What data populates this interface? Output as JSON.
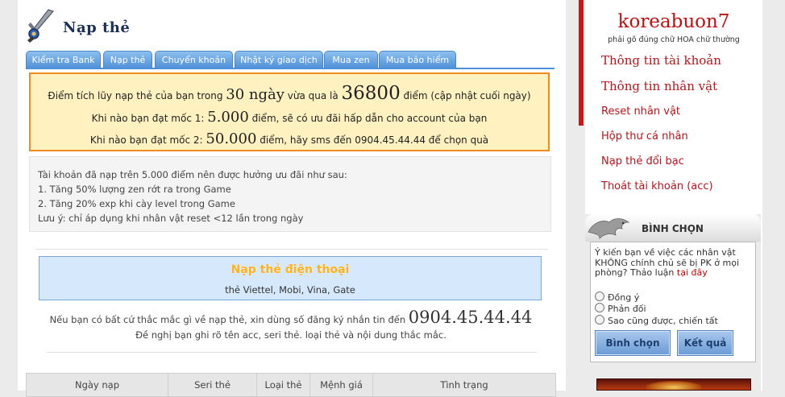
{
  "page": {
    "title": "Nạp thẻ",
    "logo_icon": "sword-shield-icon"
  },
  "tabs": [
    "Kiểm tra Bank",
    "Nạp thẻ",
    "Chuyển khoản",
    "Nhật ký giao dịch",
    "Mua zen",
    "Mua bảo hiểm"
  ],
  "notice": {
    "line1_pre": "Điểm tích lũy nạp thẻ của bạn trong",
    "line1_days": "30 ngày",
    "line1_mid": "vừa qua là",
    "line1_points": "36800",
    "line1_post": "điểm (cập nhật cuối ngày)",
    "line2_pre": "Khi nào bạn đạt mốc 1:",
    "line2_value": "5.000",
    "line2_post": "điểm, sẽ có ưu đãi hấp dẫn cho account của bạn",
    "line3_pre": "Khi nào bạn đạt mốc 2:",
    "line3_value": "50.000",
    "line3_post": "điểm, hãy sms đến 0904.45.44.44 để chọn quà"
  },
  "benefits": [
    "Tài khoản đã nạp trên 5.000 điểm nên được hưởng ưu đãi như sau:",
    "1. Tăng 50% lượng zen rớt ra trong Game",
    "2. Tăng 20% exp khi cày level trong Game",
    "Lưu ý: chỉ áp dụng khi nhân vật reset <12 lần trong ngày"
  ],
  "phone_card": {
    "title": "Nạp thẻ điện thoại",
    "subtitle": "thẻ Viettel, Mobi, Vina, Gate"
  },
  "contact": {
    "line1_pre": "Nếu bạn có bất cứ thắc mắc gì về nạp thẻ, xin dùng số đăng ký nhắn tin đến",
    "phone": "0904.45.44.44",
    "line2": "Đề nghị bạn ghi rõ tên acc, seri thẻ. loại thẻ và nội dung thắc mắc."
  },
  "table": {
    "columns": [
      "Ngày nạp",
      "Seri thẻ",
      "Loại thẻ",
      "Mệnh giá",
      "Tình trạng"
    ]
  },
  "sidebar": {
    "username": "koreabuon7",
    "hint": "phải gõ đúng chữ HOA chữ thường",
    "menu": [
      "Thông tin tài khoản",
      "Thông tin nhân vật",
      "Reset nhân vật",
      "Hộp thư cá nhân",
      "Nạp thẻ đổi bạc",
      "Thoát tài khoản (acc)"
    ]
  },
  "poll": {
    "icon": "dragon-icon",
    "title": "BÌNH CHỌN",
    "question": "Ý kiến bạn về việc các nhân vật KHÔNG chính chủ sẽ bị PK ở mọi phòng? Thảo luận",
    "discuss_link": "tại đây",
    "options": [
      "Đồng ý",
      "Phản đối",
      "Sao cũng được, chiến tất"
    ],
    "vote_button": "Bình chọn",
    "result_button": "Kết quả"
  },
  "colors": {
    "accent_red": "#b8141b",
    "tab_blue": "#4f90d8",
    "notice_border": "#f28b1e",
    "notice_bg": "#fff1c0"
  }
}
